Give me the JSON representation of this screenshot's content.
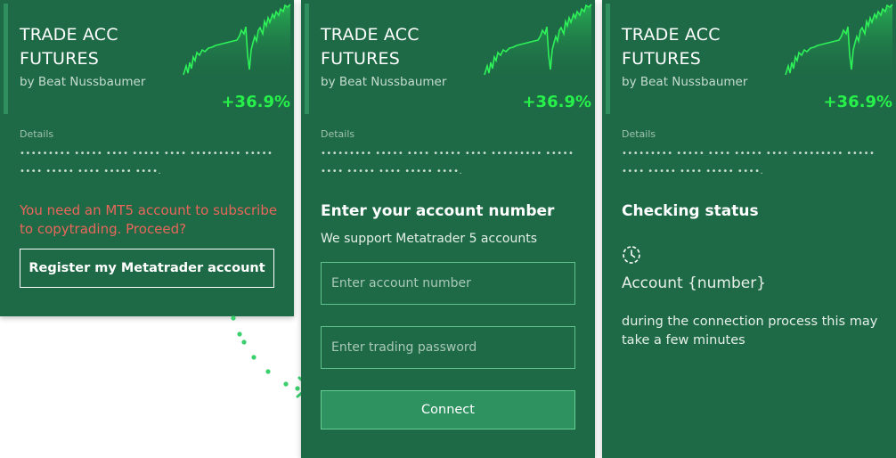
{
  "strategy": {
    "title_line1": "TRADE ACC",
    "title_line2": "FUTURES",
    "author": "by Beat Nussbaumer",
    "performance": "+36.9%",
    "details_label": "Details",
    "details_masked": "••••••••• ••••• •••• ••••• •••• ••••••••• ••••• •••• ••••• •••• ••••• ••••."
  },
  "subscribe_card": {
    "warning_text": "You need an MT5 account to subscribe to copytrading. Proceed?",
    "register_button": "Register my Metatrader account"
  },
  "connect_card": {
    "heading": "Enter your account number",
    "subheading": "We support Metatrader 5 accounts",
    "account_placeholder": "Enter account number",
    "password_placeholder": "Enter trading password",
    "connect_button": "Connect"
  },
  "status_card": {
    "heading": "Checking status",
    "status_icon": "clock-loading-icon",
    "account_label": "Account {number}",
    "info_text": "during the connection process this may take a few minutes"
  },
  "colors": {
    "card_background": "#1e6a46",
    "performance_green": "#27f04a",
    "warning_red": "#e8665a",
    "connector_green": "#3ccf6e"
  }
}
